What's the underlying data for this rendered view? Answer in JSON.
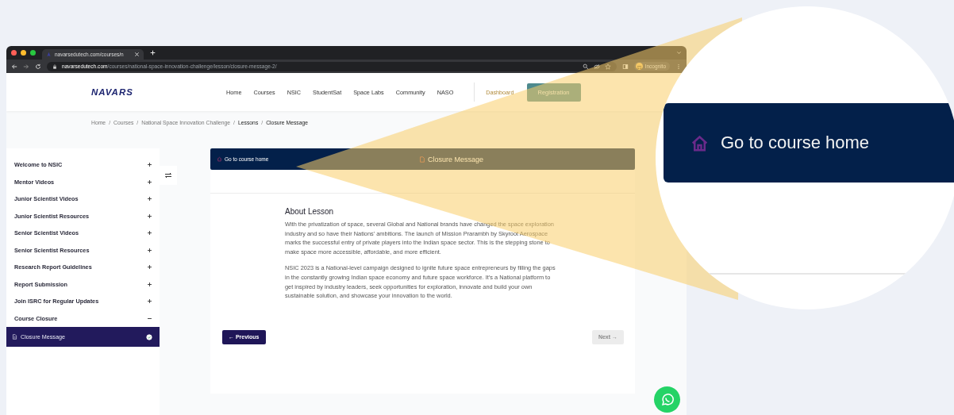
{
  "browser": {
    "tab_title": "navarsedutech.com/courses/n",
    "url_host": "navarsedutech.com",
    "url_path": "/courses/national-space-innovation-challenge/lesson/closure-message-2/",
    "profile_label": "Incognito"
  },
  "nav": {
    "logo": "NAVARS",
    "items": [
      "Home",
      "Courses",
      "NSIC",
      "StudentSat",
      "Space Labs",
      "Community",
      "NASO"
    ],
    "dashboard": "Dashboard",
    "register": "Registration"
  },
  "breadcrumb": {
    "separator": "/",
    "items": [
      {
        "label": "Home",
        "active": false
      },
      {
        "label": "Courses",
        "active": false
      },
      {
        "label": "National Space Innovation Challenge",
        "active": false
      },
      {
        "label": "Lessons",
        "active": true
      },
      {
        "label": "Closure Message",
        "active": true
      }
    ]
  },
  "sidebar": {
    "items": [
      {
        "label": "Welcome to NSIC",
        "expanded": false
      },
      {
        "label": "Mentor Videos",
        "expanded": false
      },
      {
        "label": "Junior Scientist Videos",
        "expanded": false
      },
      {
        "label": "Junior Scientist Resources",
        "expanded": false
      },
      {
        "label": "Senior Scientist Videos",
        "expanded": false
      },
      {
        "label": "Senior Scientist Resources",
        "expanded": false
      },
      {
        "label": "Research Report Guidelines",
        "expanded": false
      },
      {
        "label": "Report Submission",
        "expanded": false
      },
      {
        "label": "Join ISRC for Regular Updates",
        "expanded": false
      },
      {
        "label": "Course Closure",
        "expanded": true,
        "children": [
          {
            "label": "Closure Message",
            "selected": true,
            "completed": true
          }
        ]
      }
    ]
  },
  "lesson_banner": {
    "home_link": "Go to course home",
    "title": "Closure Message"
  },
  "content": {
    "heading": "About Lesson",
    "paragraphs": [
      "With the privatization of space, several Global and National brands have changed the space exploration industry and so have their Nations’ ambitions. The launch of Mission Prarambh by Skyroot Aerospace marks the successful entry of private players into the Indian space sector. This is the stepping stone to make space more accessible, affordable, and more efficient.",
      "NSIC 2023 is a National-level campaign designed to ignite future space entrepreneurs by filling the gaps in the constantly growing Indian space economy and future space workforce. It’s a National platform to get inspired by industry leaders, seek opportunities for exploration, innovate and build your own sustainable solution, and showcase your innovation to the world."
    ]
  },
  "pager": {
    "previous": {
      "label": "← Previous",
      "disabled": false
    },
    "next": {
      "label": "Next →",
      "disabled": true
    }
  },
  "magnifier": {
    "home_link": "Go to course home"
  }
}
